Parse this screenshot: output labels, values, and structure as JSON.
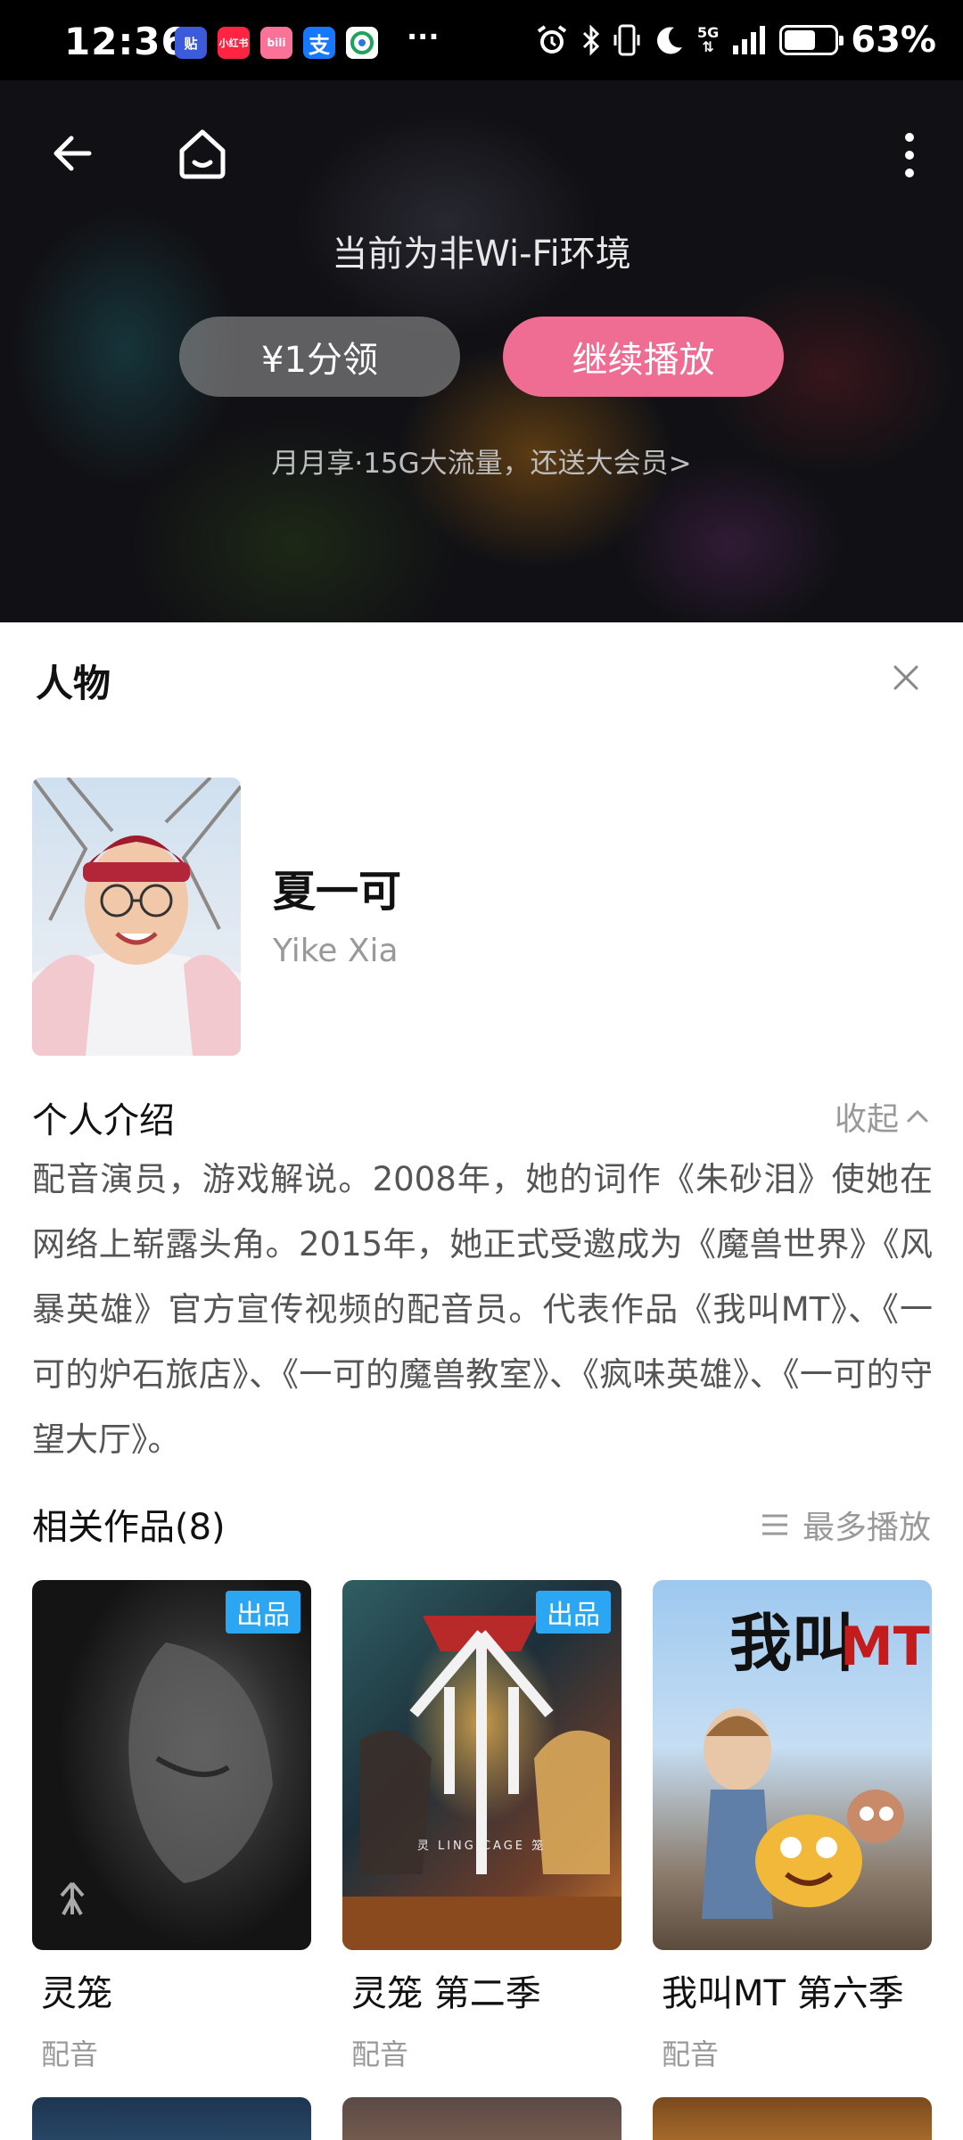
{
  "status_bar": {
    "time": "12:36",
    "app_icons": [
      {
        "label": "贴",
        "color": "#3b5bdb"
      },
      {
        "label": "小红书",
        "color": "#ff2442"
      },
      {
        "label": "bili",
        "color": "#fb7299"
      },
      {
        "label": "支",
        "color": "#1677ff"
      },
      {
        "label": "",
        "color": "#1fa35c"
      }
    ],
    "overflow": "···",
    "network": "5G",
    "battery_level": 0.63,
    "battery_text": "63%"
  },
  "player": {
    "notice": "当前为非Wi-Fi环境",
    "claim_button": "¥1分领",
    "continue_button": "继续播放",
    "promo": "月月享·15G大流量，还送大会员>",
    "accent": "#ef6c93"
  },
  "panel": {
    "title": "人物"
  },
  "person": {
    "name": "夏一可",
    "english_name": "Yike Xia"
  },
  "intro": {
    "title": "个人介绍",
    "collapse_label": "收起",
    "text": "配音演员，游戏解说。2008年，她的词作《朱砂泪》使她在网络上崭露头角。2015年，她正式受邀成为《魔兽世界》《风暴英雄》官方宣传视频的配音员。代表作品《我叫MT》、《一可的炉石旅店》、《一可的魔兽教室》、《疯味英雄》、《一可的守望大厅》。"
  },
  "works": {
    "title": "相关作品(8)",
    "sort_label": "最多播放",
    "badge_color": "#2aa6f2",
    "items": [
      {
        "title": "灵笼",
        "role": "配音",
        "badge": "出品"
      },
      {
        "title": "灵笼 第二季",
        "role": "配音",
        "badge": "出品"
      },
      {
        "title": "我叫MT 第六季",
        "role": "配音",
        "badge": ""
      }
    ]
  }
}
